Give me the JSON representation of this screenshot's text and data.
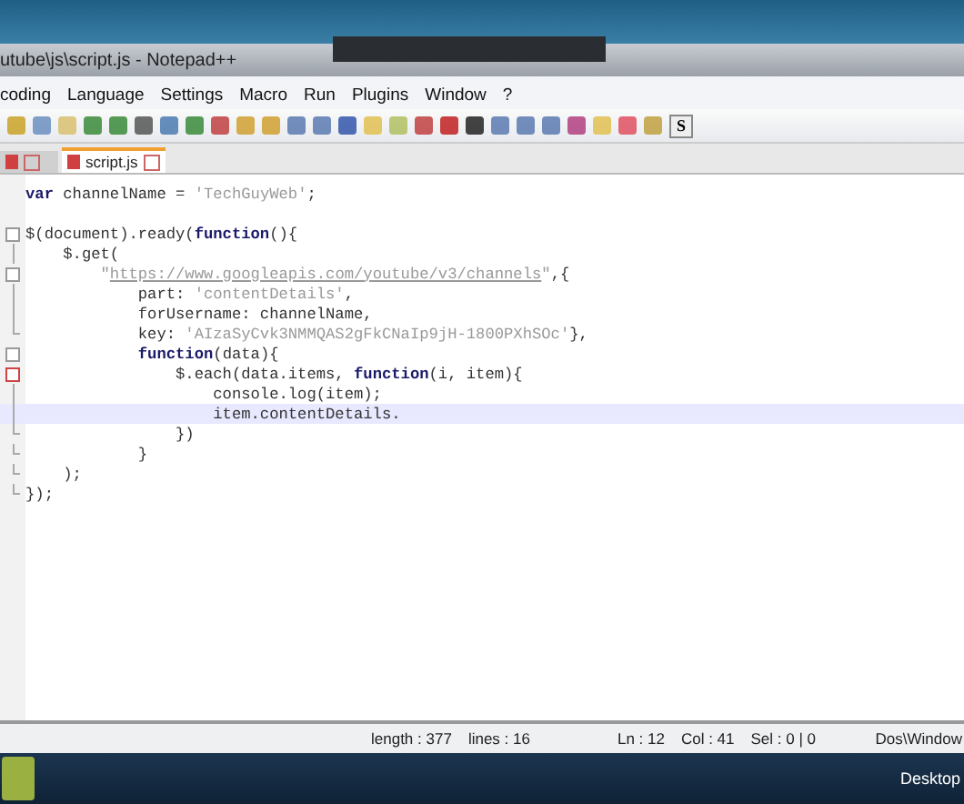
{
  "window": {
    "title": "utube\\js\\script.js - Notepad++"
  },
  "menu": [
    "coding",
    "Language",
    "Settings",
    "Macro",
    "Run",
    "Plugins",
    "Window",
    "?"
  ],
  "toolbar": {
    "s_button": "S"
  },
  "tabs": [
    {
      "selected": false
    },
    {
      "label": "script.js",
      "selected": true
    }
  ],
  "editor": {
    "lines": [
      {
        "kind": "plain",
        "selected": false,
        "tokens": [
          {
            "kind": "kw",
            "text": "var"
          },
          {
            "kind": "plain",
            "text": " channelName = "
          },
          {
            "kind": "str",
            "text": "'TechGuyWeb'"
          },
          {
            "kind": "plain",
            "text": ";"
          }
        ]
      },
      {
        "kind": "plain",
        "selected": false
      },
      {
        "kind": "fold_start",
        "selected": false,
        "tokens": [
          {
            "kind": "plain",
            "text": "$(document).ready("
          },
          {
            "kind": "kw",
            "text": "function"
          },
          {
            "kind": "plain",
            "text": "(){"
          }
        ]
      },
      {
        "kind": "fold_body",
        "selected": false,
        "tokens": [
          {
            "kind": "plain",
            "text": "    $.get("
          }
        ]
      },
      {
        "kind": "fold_start",
        "selected": false,
        "tokens": [
          {
            "kind": "str",
            "text": "        \""
          },
          {
            "kind": "link",
            "text": "https://www.googleapis.com/youtube/v3/channels"
          },
          {
            "kind": "str",
            "text": "\""
          },
          {
            "kind": "plain",
            "text": ",{"
          }
        ]
      },
      {
        "kind": "fold_body",
        "selected": false,
        "tokens": [
          {
            "kind": "plain",
            "text": "            part: "
          },
          {
            "kind": "str",
            "text": "'contentDetails'"
          },
          {
            "kind": "plain",
            "text": ","
          }
        ]
      },
      {
        "kind": "fold_body",
        "selected": false,
        "tokens": [
          {
            "kind": "plain",
            "text": "            forUsername: channelName,"
          }
        ]
      },
      {
        "kind": "fold_end",
        "selected": false,
        "tokens": [
          {
            "kind": "plain",
            "text": "            key: "
          },
          {
            "kind": "str",
            "text": "'AIzaSyCvk3NMMQAS2gFkCNaIp9jH-1800PXhSOc'"
          },
          {
            "kind": "plain",
            "text": "},"
          }
        ]
      },
      {
        "kind": "fold_start",
        "selected": false,
        "tokens": [
          {
            "kind": "kw",
            "text": "            function"
          },
          {
            "kind": "plain",
            "text": "(data){"
          }
        ]
      },
      {
        "kind": "fold_start_marked",
        "selected": false,
        "tokens": [
          {
            "kind": "plain",
            "text": "                $.each(data.items, "
          },
          {
            "kind": "kw",
            "text": "function"
          },
          {
            "kind": "plain",
            "text": "(i, item){"
          }
        ]
      },
      {
        "kind": "fold_body",
        "selected": false,
        "tokens": [
          {
            "kind": "plain",
            "text": "                    console.log(item);"
          }
        ]
      },
      {
        "kind": "fold_body",
        "selected": true,
        "tokens": [
          {
            "kind": "plain",
            "text": "                    item.contentDetails."
          }
        ]
      },
      {
        "kind": "fold_end",
        "selected": false,
        "tokens": [
          {
            "kind": "plain",
            "text": "                })"
          }
        ]
      },
      {
        "kind": "fold_end",
        "selected": false,
        "tokens": [
          {
            "kind": "plain",
            "text": "            }"
          }
        ]
      },
      {
        "kind": "fold_end",
        "selected": false,
        "tokens": [
          {
            "kind": "plain",
            "text": "    );"
          }
        ]
      },
      {
        "kind": "fold_end",
        "selected": false,
        "tokens": [
          {
            "kind": "plain",
            "text": "});"
          }
        ]
      }
    ]
  },
  "status_bar": {
    "length": "length : 377",
    "lines": "lines : 16",
    "position": "Ln : 12",
    "column": "Col : 41",
    "selection": "Sel : 0 | 0",
    "eol": "Dos\\Window"
  },
  "taskbar": {
    "desktop": "Desktop"
  }
}
